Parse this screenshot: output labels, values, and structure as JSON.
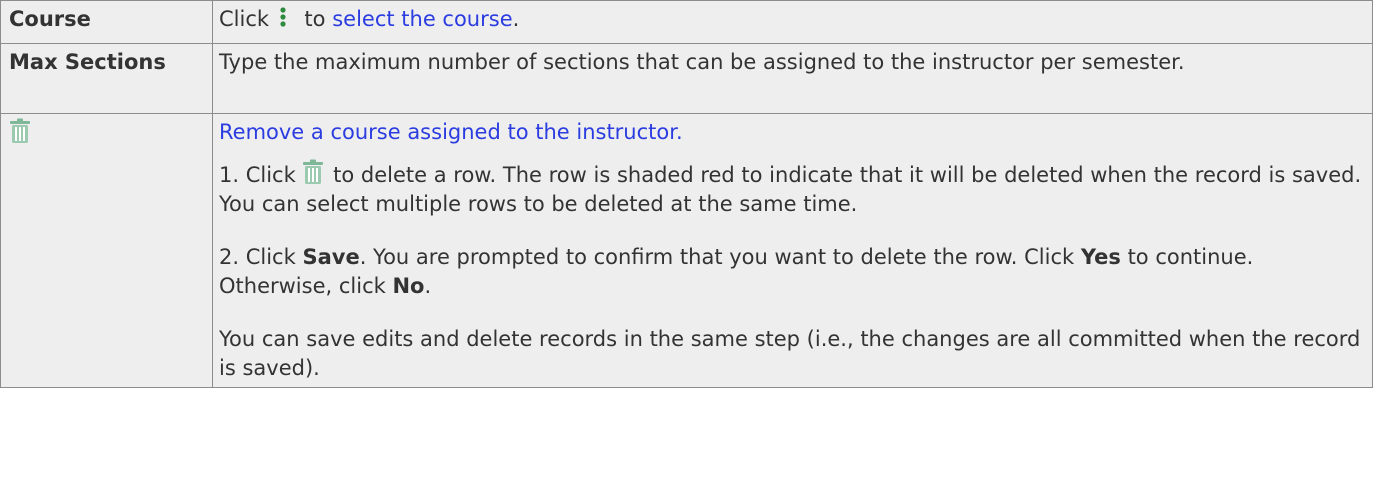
{
  "rows": [
    {
      "label": "Course",
      "text_pre": "Click",
      "text_mid": "to",
      "link": "select the course",
      "text_post": "."
    },
    {
      "label": "Max Sections",
      "text": "Type the maximum number of sections that can be assigned to the instructor per semester."
    },
    {
      "icon": "trash-icon",
      "link": "Remove a course assigned to the instructor.",
      "step1_pre": "1. Click",
      "step1_post": "to delete a row. The row is shaded red to indicate that it will be deleted when the record is saved. You can select multiple rows to be deleted at the same time.",
      "step2_pre": "2. Click",
      "step2_bold1": "Save",
      "step2_mid": ". You are prompted to confirm that you want to delete the row. Click",
      "step2_bold2": "Yes",
      "step2_mid2": "to continue. Otherwise, click",
      "step2_bold3": "No",
      "step2_post": ".",
      "note": "You can save edits and delete records in the same step (i.e., the changes are all committed when the record is saved)."
    }
  ],
  "colors": {
    "link": "#2b3ce0",
    "border": "#8c8c8c",
    "cell_background": "#eeeeee",
    "icon_green": "#7fb898"
  }
}
